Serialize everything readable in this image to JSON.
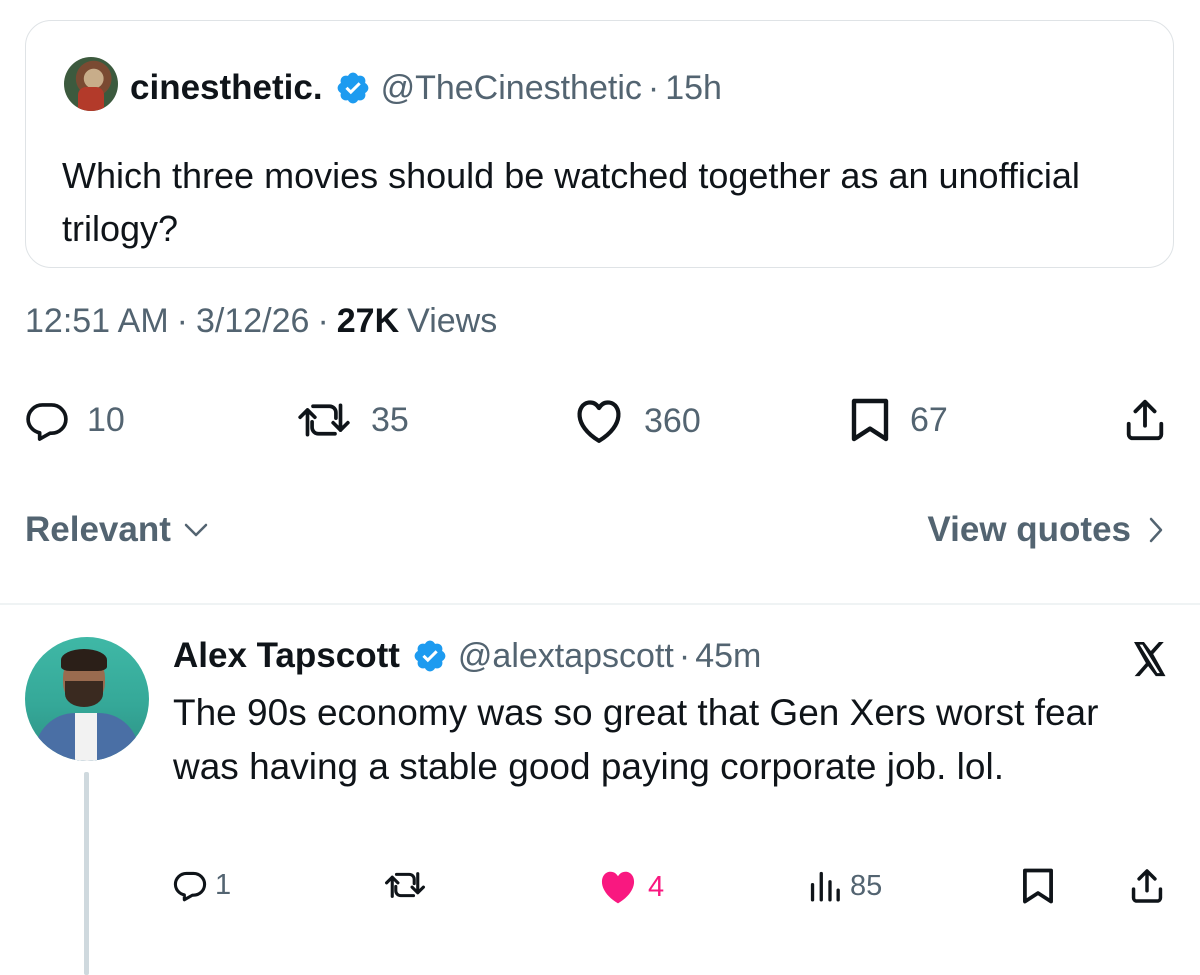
{
  "quoted": {
    "name": "cinesthetic.",
    "handle": "@TheCinesthetic",
    "dot": "·",
    "time": "15h",
    "text": "Which three movies should be watched together as an unofficial trilogy?"
  },
  "meta": {
    "time": "12:51 AM",
    "sep1": "·",
    "date": "3/12/26",
    "sep2": "·",
    "views_count": "27K",
    "views_label": "Views"
  },
  "actions": {
    "replies": "10",
    "reposts": "35",
    "likes": "360",
    "bookmarks": "67"
  },
  "sort": {
    "label": "Relevant",
    "view_quotes": "View quotes"
  },
  "reply": {
    "name": "Alex Tapscott",
    "handle": "@alextapscott",
    "dot": "·",
    "time": "45m",
    "text": "The 90s economy was so great that Gen Xers worst fear was having a stable good paying corporate job. lol.",
    "actions": {
      "replies": "1",
      "likes": "4",
      "views": "85"
    }
  },
  "colors": {
    "verified": "#1d9bf0",
    "secondary_text": "#536471",
    "like_active": "#f91880"
  },
  "icons": [
    "verified-badge-icon",
    "reply-icon",
    "repost-icon",
    "like-icon",
    "bookmark-icon",
    "share-icon",
    "chevron-down-icon",
    "chevron-right-icon",
    "x-logo-icon",
    "views-icon"
  ]
}
